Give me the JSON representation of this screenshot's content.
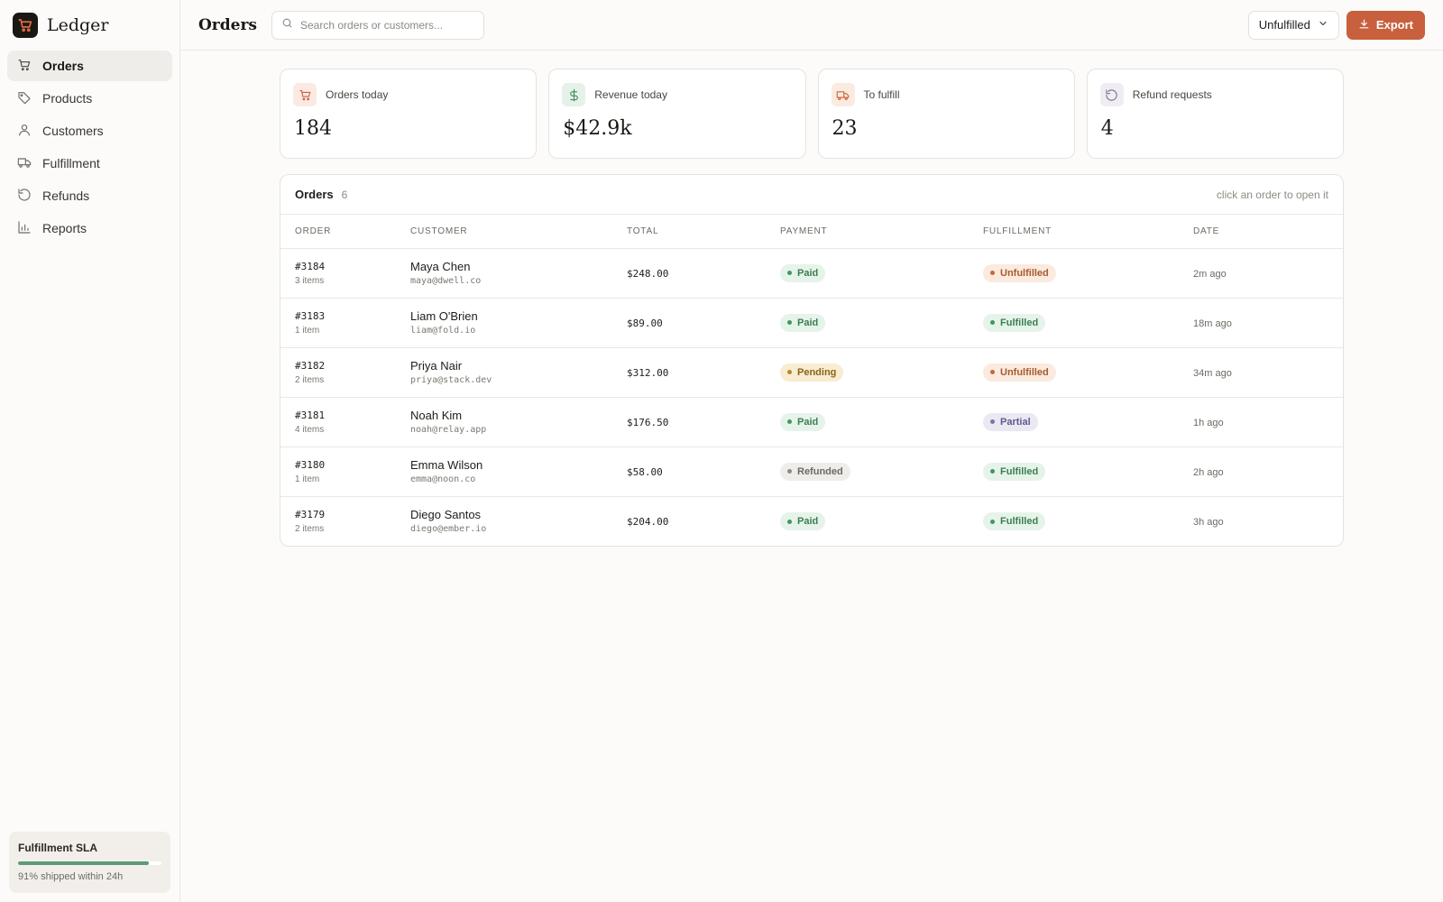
{
  "brand": {
    "name": "Ledger"
  },
  "colors": {
    "accent": "#c8603d",
    "success": "#3f9a5a",
    "warning": "#b98a22",
    "sla_bar": "#5e9a76"
  },
  "sidebar": {
    "items": [
      {
        "label": "Orders",
        "icon": "cart-icon",
        "active": true
      },
      {
        "label": "Products",
        "icon": "tag-icon"
      },
      {
        "label": "Customers",
        "icon": "user-icon"
      },
      {
        "label": "Fulfillment",
        "icon": "truck-icon"
      },
      {
        "label": "Refunds",
        "icon": "refund-icon"
      },
      {
        "label": "Reports",
        "icon": "bar-chart-icon"
      }
    ],
    "sla": {
      "title": "Fulfillment SLA",
      "percent": 91,
      "text": "91% shipped within 24h"
    }
  },
  "header": {
    "title": "Orders",
    "search_placeholder": "Search orders or customers...",
    "filter_label": "Unfulfilled",
    "export_label": "Export"
  },
  "stats": [
    {
      "label": "Orders today",
      "value": "184",
      "icon": "cart-icon"
    },
    {
      "label": "Revenue today",
      "value": "$42.9k",
      "icon": "dollar-icon"
    },
    {
      "label": "To fulfill",
      "value": "23",
      "icon": "truck-icon"
    },
    {
      "label": "Refund requests",
      "value": "4",
      "icon": "refund-icon"
    }
  ],
  "orders_table": {
    "title": "Orders",
    "count": "6",
    "hint": "click an order to open it",
    "columns": [
      "ORDER",
      "CUSTOMER",
      "TOTAL",
      "PAYMENT",
      "FULFILLMENT",
      "DATE"
    ],
    "rows": [
      {
        "id": "#3184",
        "items": "3 items",
        "name": "Maya Chen",
        "email": "maya@dwell.co",
        "total": "$248.00",
        "payment": "Paid",
        "fulfillment": "Unfulfilled",
        "date": "2m ago"
      },
      {
        "id": "#3183",
        "items": "1 item",
        "name": "Liam O'Brien",
        "email": "liam@fold.io",
        "total": "$89.00",
        "payment": "Paid",
        "fulfillment": "Fulfilled",
        "date": "18m ago"
      },
      {
        "id": "#3182",
        "items": "2 items",
        "name": "Priya Nair",
        "email": "priya@stack.dev",
        "total": "$312.00",
        "payment": "Pending",
        "fulfillment": "Unfulfilled",
        "date": "34m ago"
      },
      {
        "id": "#3181",
        "items": "4 items",
        "name": "Noah Kim",
        "email": "noah@relay.app",
        "total": "$176.50",
        "payment": "Paid",
        "fulfillment": "Partial",
        "date": "1h ago"
      },
      {
        "id": "#3180",
        "items": "1 item",
        "name": "Emma Wilson",
        "email": "emma@noon.co",
        "total": "$58.00",
        "payment": "Refunded",
        "fulfillment": "Fulfilled",
        "date": "2h ago"
      },
      {
        "id": "#3179",
        "items": "2 items",
        "name": "Diego Santos",
        "email": "diego@ember.io",
        "total": "$204.00",
        "payment": "Paid",
        "fulfillment": "Fulfilled",
        "date": "3h ago"
      }
    ]
  }
}
